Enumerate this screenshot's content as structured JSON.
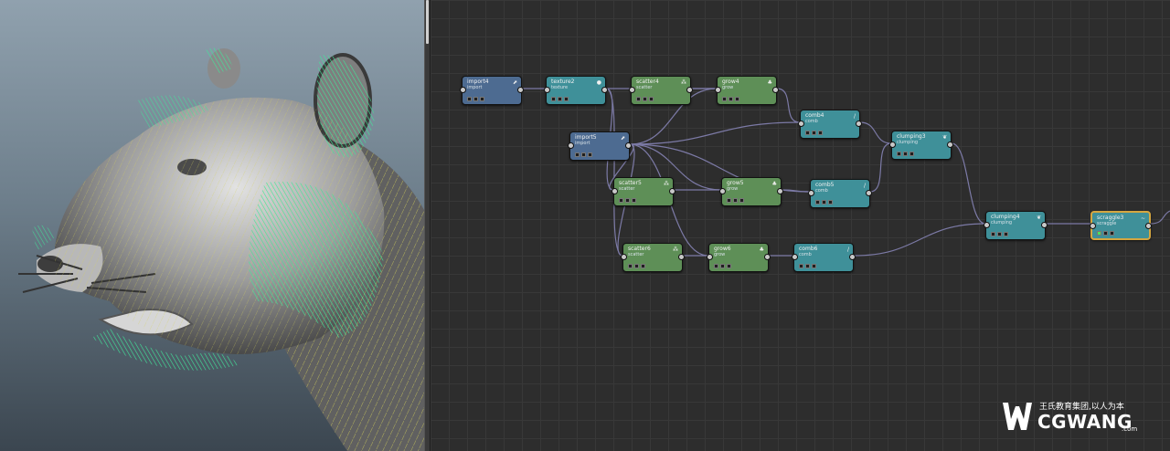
{
  "graph": {
    "nodes": [
      {
        "id": "import4",
        "title": "import4",
        "sub": "import",
        "color": "blue",
        "icon": "⬈"
      },
      {
        "id": "texture2",
        "title": "texture2",
        "sub": "texture",
        "color": "teal",
        "icon": "●"
      },
      {
        "id": "scatter4",
        "title": "scatter4",
        "sub": "scatter",
        "color": "green",
        "icon": "⁂"
      },
      {
        "id": "grow4",
        "title": "grow4",
        "sub": "grow",
        "color": "green",
        "icon": "♣"
      },
      {
        "id": "comb4",
        "title": "comb4",
        "sub": "comb",
        "color": "teal",
        "icon": "/"
      },
      {
        "id": "import5",
        "title": "import5",
        "sub": "import",
        "color": "blue",
        "icon": "⬈"
      },
      {
        "id": "clumping3",
        "title": "clumping3",
        "sub": "clumping",
        "color": "teal",
        "icon": "❦"
      },
      {
        "id": "scatter5",
        "title": "scatter5",
        "sub": "scatter",
        "color": "green",
        "icon": "⁂"
      },
      {
        "id": "grow5",
        "title": "grow5",
        "sub": "grow",
        "color": "green",
        "icon": "♣"
      },
      {
        "id": "comb5",
        "title": "comb5",
        "sub": "comb",
        "color": "teal",
        "icon": "/"
      },
      {
        "id": "clumping4",
        "title": "clumping4",
        "sub": "clumping",
        "color": "teal",
        "icon": "❦"
      },
      {
        "id": "scraggle3",
        "title": "scraggle3",
        "sub": "scraggle",
        "color": "teal",
        "icon": "~",
        "selected": true
      },
      {
        "id": "scatter6",
        "title": "scatter6",
        "sub": "scatter",
        "color": "green",
        "icon": "⁂"
      },
      {
        "id": "grow6",
        "title": "grow6",
        "sub": "grow",
        "color": "green",
        "icon": "♣"
      },
      {
        "id": "comb6",
        "title": "comb6",
        "sub": "comb",
        "color": "teal",
        "icon": "/"
      }
    ]
  },
  "watermark": {
    "slogan": "王氏教育集团,以人为本",
    "brand": "CGWANG",
    "domain": ".com"
  },
  "colors": {
    "node_blue": "#4d6b91",
    "node_teal": "#3f9099",
    "node_green": "#5e8f57",
    "wire": "#7c7aa6",
    "selected_border": "#d5a640"
  }
}
